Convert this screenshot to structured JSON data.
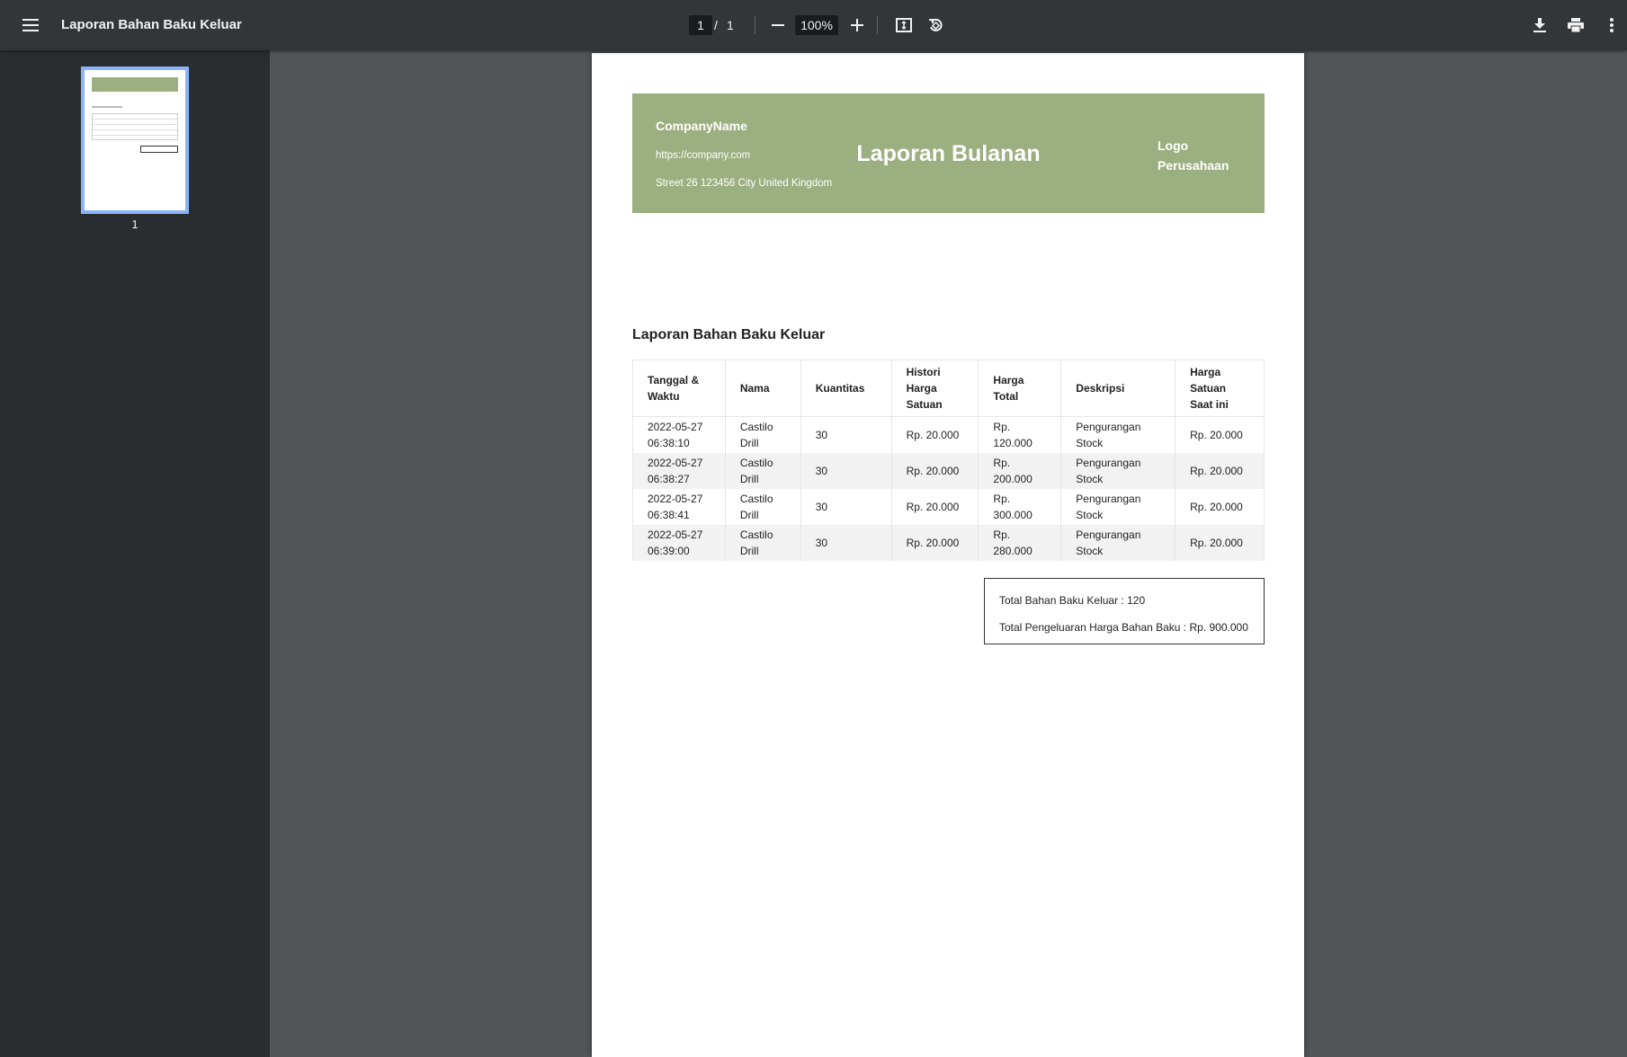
{
  "toolbar": {
    "title": "Laporan Bahan Baku Keluar",
    "page_current": "1",
    "page_separator": "/",
    "page_total": "1",
    "zoom": "100%"
  },
  "sidebar": {
    "thumbnails": [
      {
        "label": "1"
      }
    ]
  },
  "document": {
    "company_name": "CompanyName",
    "company_url": "https://company.com",
    "company_address": "Street 26 123456 City United Kingdom",
    "report_title": "Laporan Bulanan",
    "logo_line1": "Logo",
    "logo_line2": "Perusahaan",
    "section_title": "Laporan Bahan Baku Keluar",
    "table": {
      "headers": [
        [
          "Tanggal &",
          "Waktu"
        ],
        [
          "Nama"
        ],
        [
          "Kuantitas"
        ],
        [
          "Histori",
          "Harga",
          "Satuan"
        ],
        [
          "Harga",
          "Total"
        ],
        [
          "Deskripsi"
        ],
        [
          "Harga",
          "Satuan",
          "Saat ini"
        ]
      ],
      "rows": [
        {
          "date": "2022-05-27",
          "time": "06:38:10",
          "name1": "Castilo",
          "name2": "Drill",
          "qty": "30",
          "hist_price": "Rp. 20.000",
          "total1": "Rp.",
          "total2": "120.000",
          "desc1": "Pengurangan",
          "desc2": "Stock",
          "current_price": "Rp. 20.000"
        },
        {
          "date": "2022-05-27",
          "time": "06:38:27",
          "name1": "Castilo",
          "name2": "Drill",
          "qty": "30",
          "hist_price": "Rp. 20.000",
          "total1": "Rp.",
          "total2": "200.000",
          "desc1": "Pengurangan",
          "desc2": "Stock",
          "current_price": "Rp. 20.000"
        },
        {
          "date": "2022-05-27",
          "time": "06:38:41",
          "name1": "Castilo",
          "name2": "Drill",
          "qty": "30",
          "hist_price": "Rp. 20.000",
          "total1": "Rp.",
          "total2": "300.000",
          "desc1": "Pengurangan",
          "desc2": "Stock",
          "current_price": "Rp. 20.000"
        },
        {
          "date": "2022-05-27",
          "time": "06:39:00",
          "name1": "Castilo",
          "name2": "Drill",
          "qty": "30",
          "hist_price": "Rp. 20.000",
          "total1": "Rp.",
          "total2": "280.000",
          "desc1": "Pengurangan",
          "desc2": "Stock",
          "current_price": "Rp. 20.000"
        }
      ]
    },
    "summary": {
      "total_qty": "Total Bahan Baku Keluar : 120",
      "total_cost": "Total Pengeluaran Harga Bahan Baku : Rp. 900.000"
    }
  },
  "colors": {
    "toolbar_bg": "#323639",
    "sidebar_bg": "#2a2d30",
    "viewer_bg": "#525659",
    "header_band": "#9caf80",
    "thumb_border": "#8ab4f8"
  },
  "icons": {
    "menu": "hamburger-menu-icon",
    "zoom_out": "minus-icon",
    "zoom_in": "plus-icon",
    "fit": "fit-to-page-icon",
    "rotate": "rotate-icon",
    "download": "download-icon",
    "print": "print-icon",
    "more": "more-vertical-icon"
  }
}
